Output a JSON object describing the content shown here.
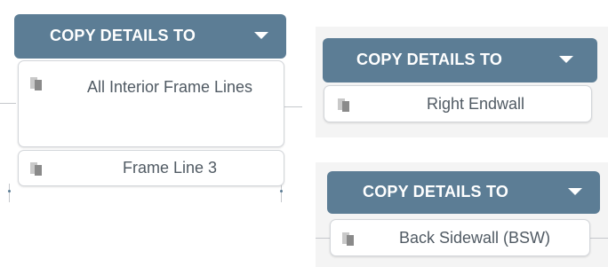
{
  "colors": {
    "button_bg": "#5c7d95",
    "button_text": "#ffffff",
    "option_text": "#505a63",
    "option_border": "#d3d6da",
    "icon_front": "#8a8a8a",
    "icon_back": "#c9c9c9"
  },
  "panels": [
    {
      "button": {
        "label": "COPY DETAILS TO",
        "caret_icon": "caret-down-icon"
      },
      "options": [
        {
          "label": "All Interior Frame Lines",
          "icon": "copy-icon"
        },
        {
          "label": "Frame Line 3",
          "icon": "copy-icon"
        }
      ]
    },
    {
      "button": {
        "label": "COPY DETAILS TO",
        "caret_icon": "caret-down-icon"
      },
      "options": [
        {
          "label": "Right Endwall",
          "icon": "copy-icon"
        }
      ]
    },
    {
      "button": {
        "label": "COPY DETAILS TO",
        "caret_icon": "caret-down-icon"
      },
      "options": [
        {
          "label": "Back Sidewall (BSW)",
          "icon": "copy-icon"
        }
      ]
    }
  ]
}
